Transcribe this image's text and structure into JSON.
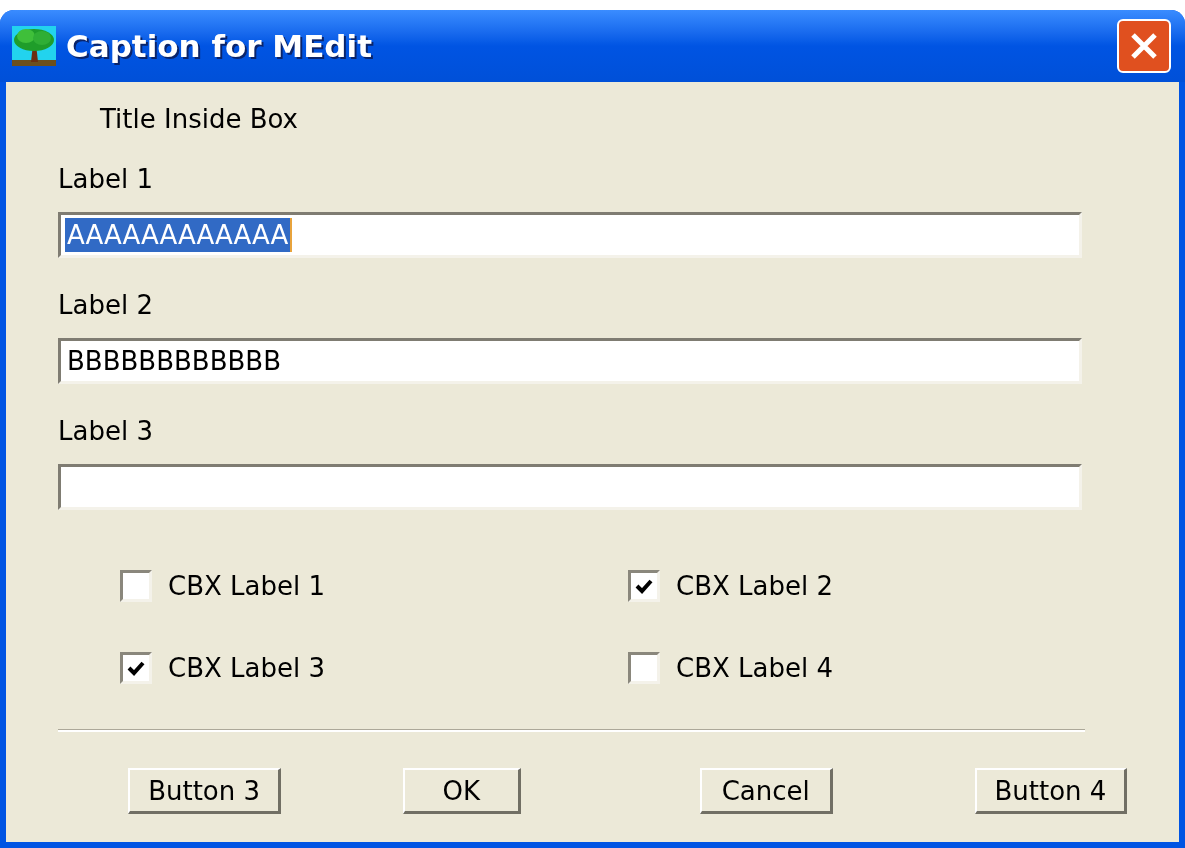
{
  "window": {
    "title": "Caption for MEdit"
  },
  "title_inside_box": "Title Inside Box",
  "fields": [
    {
      "label": "Label 1",
      "value": "AAAAAAAAAAAA",
      "text_selected": true
    },
    {
      "label": "Label 2",
      "value": "BBBBBBBBBBBB",
      "text_selected": false
    },
    {
      "label": "Label 3"
    }
  ],
  "checkboxes": [
    {
      "label": "CBX Label 1",
      "checked": false
    },
    {
      "label": "CBX Label 2",
      "checked": true
    },
    {
      "label": "CBX Label 3",
      "checked": true
    },
    {
      "label": "CBX Label 4",
      "checked": false
    }
  ],
  "buttons": [
    {
      "label": "Button 3"
    },
    {
      "label": "OK"
    },
    {
      "label": "Cancel"
    },
    {
      "label": "Button 4"
    }
  ]
}
